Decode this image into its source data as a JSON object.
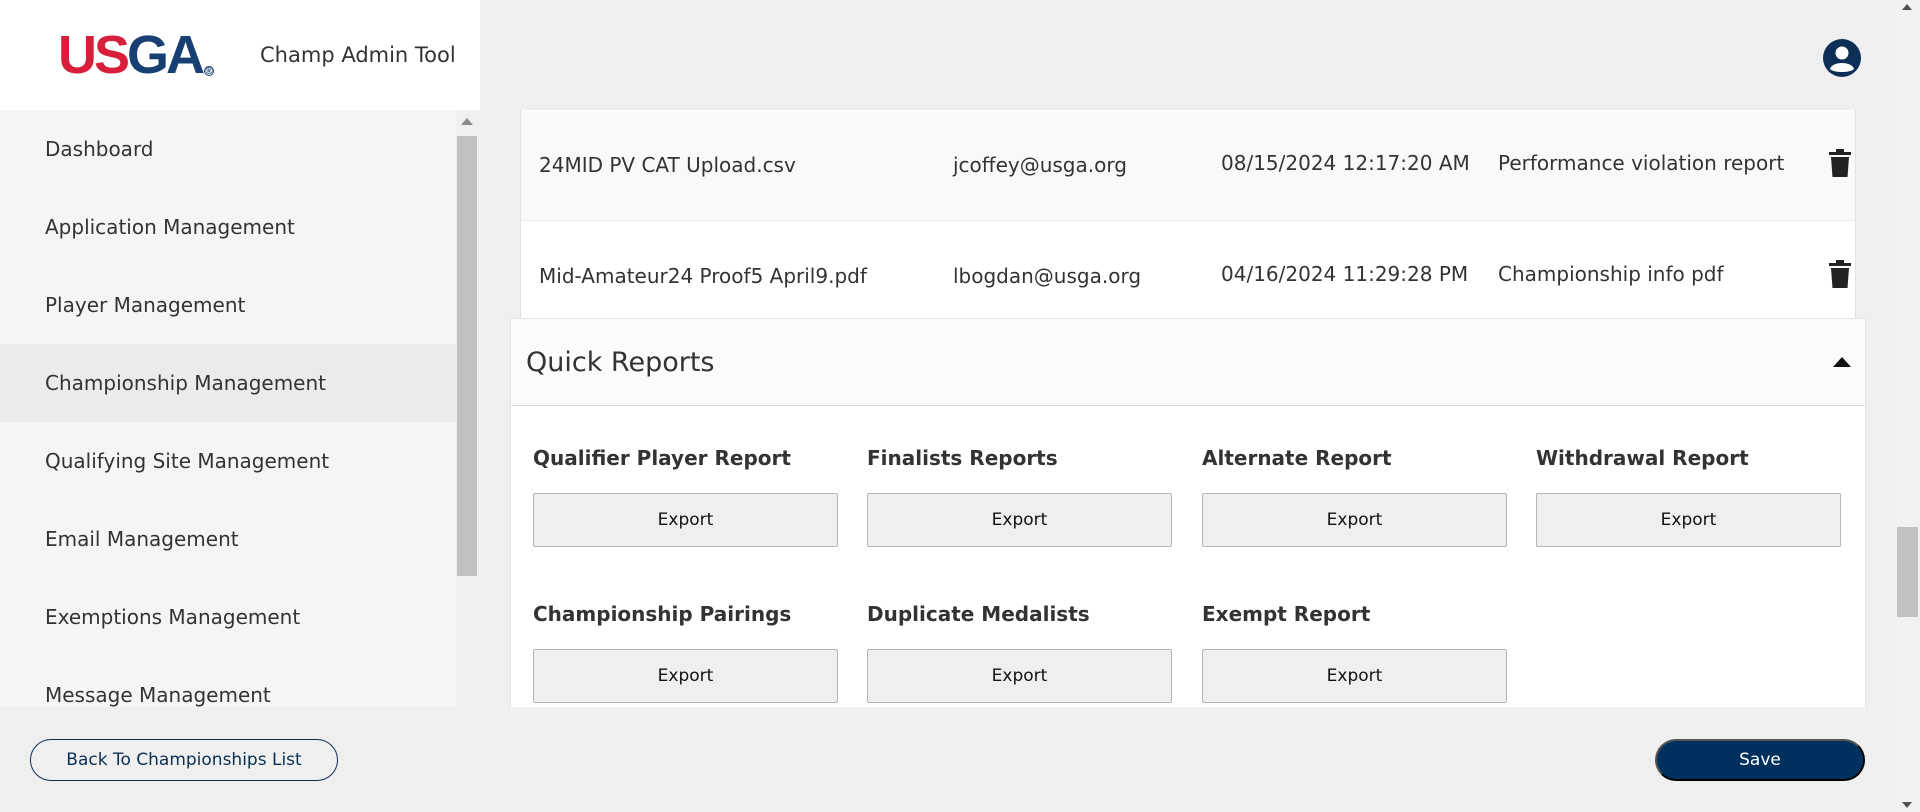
{
  "header": {
    "logo_us": "US",
    "logo_ga": "GA",
    "app_title": "Champ Admin Tool",
    "user_icon": "user-circle-icon"
  },
  "sidebar": {
    "items": [
      {
        "label": "Dashboard"
      },
      {
        "label": "Application Management"
      },
      {
        "label": "Player Management"
      },
      {
        "label": "Championship Management",
        "active": true
      },
      {
        "label": "Qualifying Site Management"
      },
      {
        "label": "Email Management"
      },
      {
        "label": "Exemptions Management"
      },
      {
        "label": "Message Management"
      }
    ]
  },
  "files": {
    "rows": [
      {
        "name": "24MID PV CAT Upload.csv",
        "user": "jcoffey@usga.org",
        "date": "08/15/2024 12:17:20 AM",
        "type": "Performance violation report"
      },
      {
        "name": "Mid-Amateur24 Proof5 April9.pdf",
        "user": "lbogdan@usga.org",
        "date": "04/16/2024 11:29:28 PM",
        "type": "Championship info pdf"
      }
    ],
    "delete_icon": "trash-icon"
  },
  "quick_reports": {
    "title": "Quick Reports",
    "export_label": "Export",
    "reports": [
      {
        "label": "Qualifier Player Report"
      },
      {
        "label": "Finalists Reports"
      },
      {
        "label": "Alternate Report"
      },
      {
        "label": "Withdrawal Report"
      },
      {
        "label": "Championship Pairings"
      },
      {
        "label": "Duplicate Medalists"
      },
      {
        "label": "Exempt Report"
      }
    ]
  },
  "footer": {
    "back_label": "Back To Championships List",
    "save_label": "Save"
  },
  "colors": {
    "brand_red": "#d71f3c",
    "brand_navy": "#173f73",
    "button_navy": "#00315e"
  }
}
